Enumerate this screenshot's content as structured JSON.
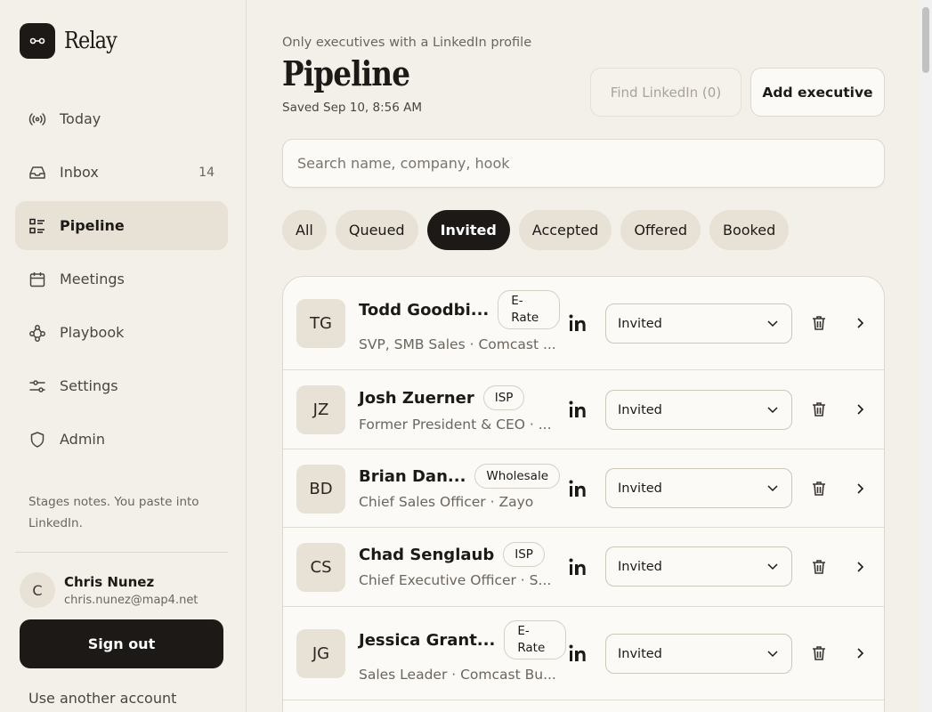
{
  "app": {
    "name": "Relay"
  },
  "sidebar": {
    "items": [
      {
        "label": "Today",
        "icon": "broadcast-icon",
        "count": ""
      },
      {
        "label": "Inbox",
        "icon": "inbox-icon",
        "count": "14"
      },
      {
        "label": "Pipeline",
        "icon": "list-icon",
        "count": "",
        "active": true
      },
      {
        "label": "Meetings",
        "icon": "calendar-icon",
        "count": ""
      },
      {
        "label": "Playbook",
        "icon": "flow-icon",
        "count": ""
      },
      {
        "label": "Settings",
        "icon": "sliders-icon",
        "count": ""
      },
      {
        "label": "Admin",
        "icon": "shield-icon",
        "count": ""
      }
    ],
    "note": "Stages notes. You paste into LinkedIn.",
    "user": {
      "initial": "C",
      "name": "Chris Nunez",
      "email": "chris.nunez@map4.net"
    },
    "signout_label": "Sign out",
    "other_account_label": "Use another account"
  },
  "main": {
    "filter_note": "Only executives with a LinkedIn profile",
    "title": "Pipeline",
    "saved": "Saved Sep 10, 8:56 AM",
    "find_label": "Find LinkedIn (0)",
    "add_label": "Add executive",
    "search_placeholder": "Search name, company, hook",
    "tabs": [
      {
        "label": "All"
      },
      {
        "label": "Queued"
      },
      {
        "label": "Invited",
        "active": true
      },
      {
        "label": "Accepted"
      },
      {
        "label": "Offered"
      },
      {
        "label": "Booked"
      }
    ],
    "rows": [
      {
        "initials": "TG",
        "name": "Todd Goodbi...",
        "tag": "E-Rate",
        "subtitle": "SVP, SMB Sales · Comcast ...",
        "status": "Invited"
      },
      {
        "initials": "JZ",
        "name": "Josh Zuerner",
        "tag": "ISP",
        "subtitle": "Former President & CEO · ...",
        "status": "Invited"
      },
      {
        "initials": "BD",
        "name": "Brian Dan...",
        "tag": "Wholesale",
        "subtitle": "Chief Sales Officer · Zayo",
        "status": "Invited"
      },
      {
        "initials": "CS",
        "name": "Chad Senglaub",
        "tag": "ISP",
        "subtitle": "Chief Executive Officer · S...",
        "status": "Invited"
      },
      {
        "initials": "JG",
        "name": "Jessica Grant...",
        "tag": "E-Rate",
        "subtitle": "Sales Leader · Comcast Bu...",
        "status": "Invited"
      }
    ]
  },
  "colors": {
    "accent": "#1c1917",
    "background": "#f3f0e9",
    "surface": "#fbfaf6",
    "muted": "#6b655e"
  }
}
